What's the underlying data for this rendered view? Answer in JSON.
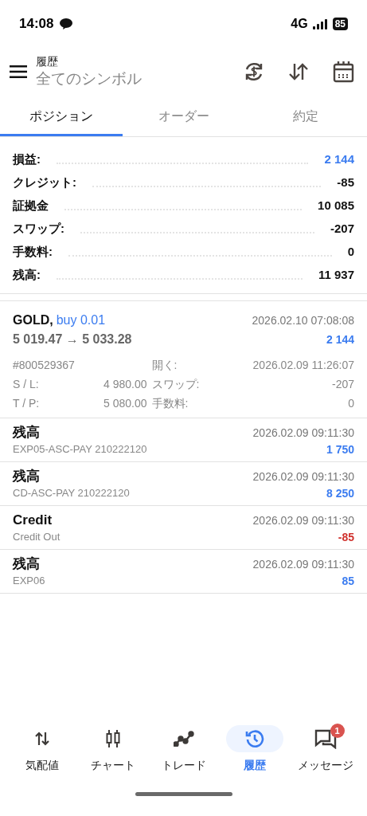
{
  "status_bar": {
    "time": "14:08",
    "network": "4G",
    "battery": "85"
  },
  "header": {
    "title": "履歴",
    "subtitle": "全てのシンボル"
  },
  "tabs": [
    {
      "label": "ポジション",
      "selected": true
    },
    {
      "label": "オーダー",
      "selected": false
    },
    {
      "label": "約定",
      "selected": false
    }
  ],
  "summary": [
    {
      "label": "損益:",
      "value": "2 144",
      "color": "#3b7cf0"
    },
    {
      "label": "クレジット:",
      "value": "-85",
      "color": "#111111"
    },
    {
      "label": "証拠金",
      "value": "10 085",
      "color": "#111111"
    },
    {
      "label": "スワップ:",
      "value": "-207",
      "color": "#111111"
    },
    {
      "label": "手数料:",
      "value": "0",
      "color": "#111111"
    },
    {
      "label": "残高:",
      "value": "11 937",
      "color": "#111111"
    }
  ],
  "position": {
    "symbol": "GOLD,",
    "side": "buy 0.01",
    "prices": "5 019.47 → 5 033.28",
    "close_time": "2026.02.10 07:08:08",
    "profit": "2 144",
    "ticket": "#800529367",
    "open_label": "開く:",
    "open_time": "2026.02.09 11:26:07",
    "sl_label": "S / L:",
    "sl": "4 980.00",
    "swap_label": "スワップ:",
    "swap": "-207",
    "tp_label": "T / P:",
    "tp": "5 080.00",
    "fee_label": "手数料:",
    "fee": "0"
  },
  "deals": [
    {
      "title": "残高",
      "comment": "EXP05-ASC-PAY 210222120",
      "time": "2026.02.09 09:11:30",
      "amount": "1 750",
      "color": "#3b7cf0"
    },
    {
      "title": "残高",
      "comment": "CD-ASC-PAY 210222120",
      "time": "2026.02.09 09:11:30",
      "amount": "8 250",
      "color": "#3b7cf0"
    },
    {
      "title": "Credit",
      "comment": "Credit Out",
      "time": "2026.02.09 09:11:30",
      "amount": "-85",
      "color": "#d0312d"
    },
    {
      "title": "残高",
      "comment": "EXP06",
      "time": "2026.02.09 09:11:30",
      "amount": "85",
      "color": "#3b7cf0"
    }
  ],
  "bottom_nav": [
    {
      "label": "気配値",
      "kind": "quotes",
      "selected": false
    },
    {
      "label": "チャート",
      "kind": "chart",
      "selected": false
    },
    {
      "label": "トレード",
      "kind": "trade",
      "selected": false
    },
    {
      "label": "履歴",
      "kind": "history",
      "selected": true
    },
    {
      "label": "メッセージ",
      "kind": "messages",
      "selected": false,
      "badge": "1"
    }
  ]
}
